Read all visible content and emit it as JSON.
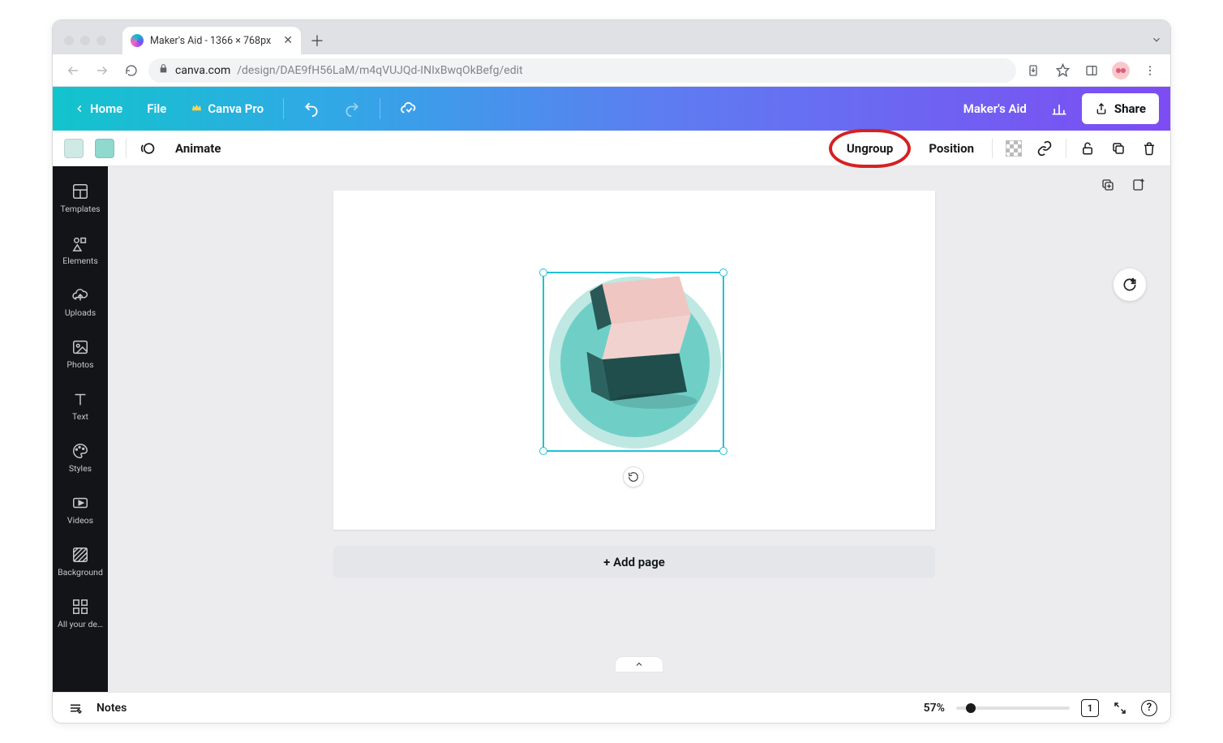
{
  "browser": {
    "tab_title": "Maker's Aid - 1366 × 768px",
    "url_host": "canva.com",
    "url_path": "/design/DAE9fH56LaM/m4qVUJQd-INIxBwqOkBefg/edit"
  },
  "header": {
    "home": "Home",
    "file": "File",
    "pro": "Canva Pro",
    "project_title": "Maker's Aid",
    "share": "Share"
  },
  "context_toolbar": {
    "swatches": [
      "#cfe9e5",
      "#8fd9cf"
    ],
    "animate": "Animate",
    "ungroup": "Ungroup",
    "position": "Position"
  },
  "sidebar": {
    "items": [
      {
        "label": "Templates",
        "icon": "layout"
      },
      {
        "label": "Elements",
        "icon": "shapes"
      },
      {
        "label": "Uploads",
        "icon": "cloud-up"
      },
      {
        "label": "Photos",
        "icon": "image"
      },
      {
        "label": "Text",
        "icon": "text"
      },
      {
        "label": "Styles",
        "icon": "palette"
      },
      {
        "label": "Videos",
        "icon": "video"
      },
      {
        "label": "Background",
        "icon": "hatch"
      },
      {
        "label": "All your de…",
        "icon": "grid"
      }
    ]
  },
  "canvas": {
    "add_page": "+ Add page"
  },
  "footer": {
    "notes": "Notes",
    "zoom": "57%",
    "page_indicator": "1"
  }
}
